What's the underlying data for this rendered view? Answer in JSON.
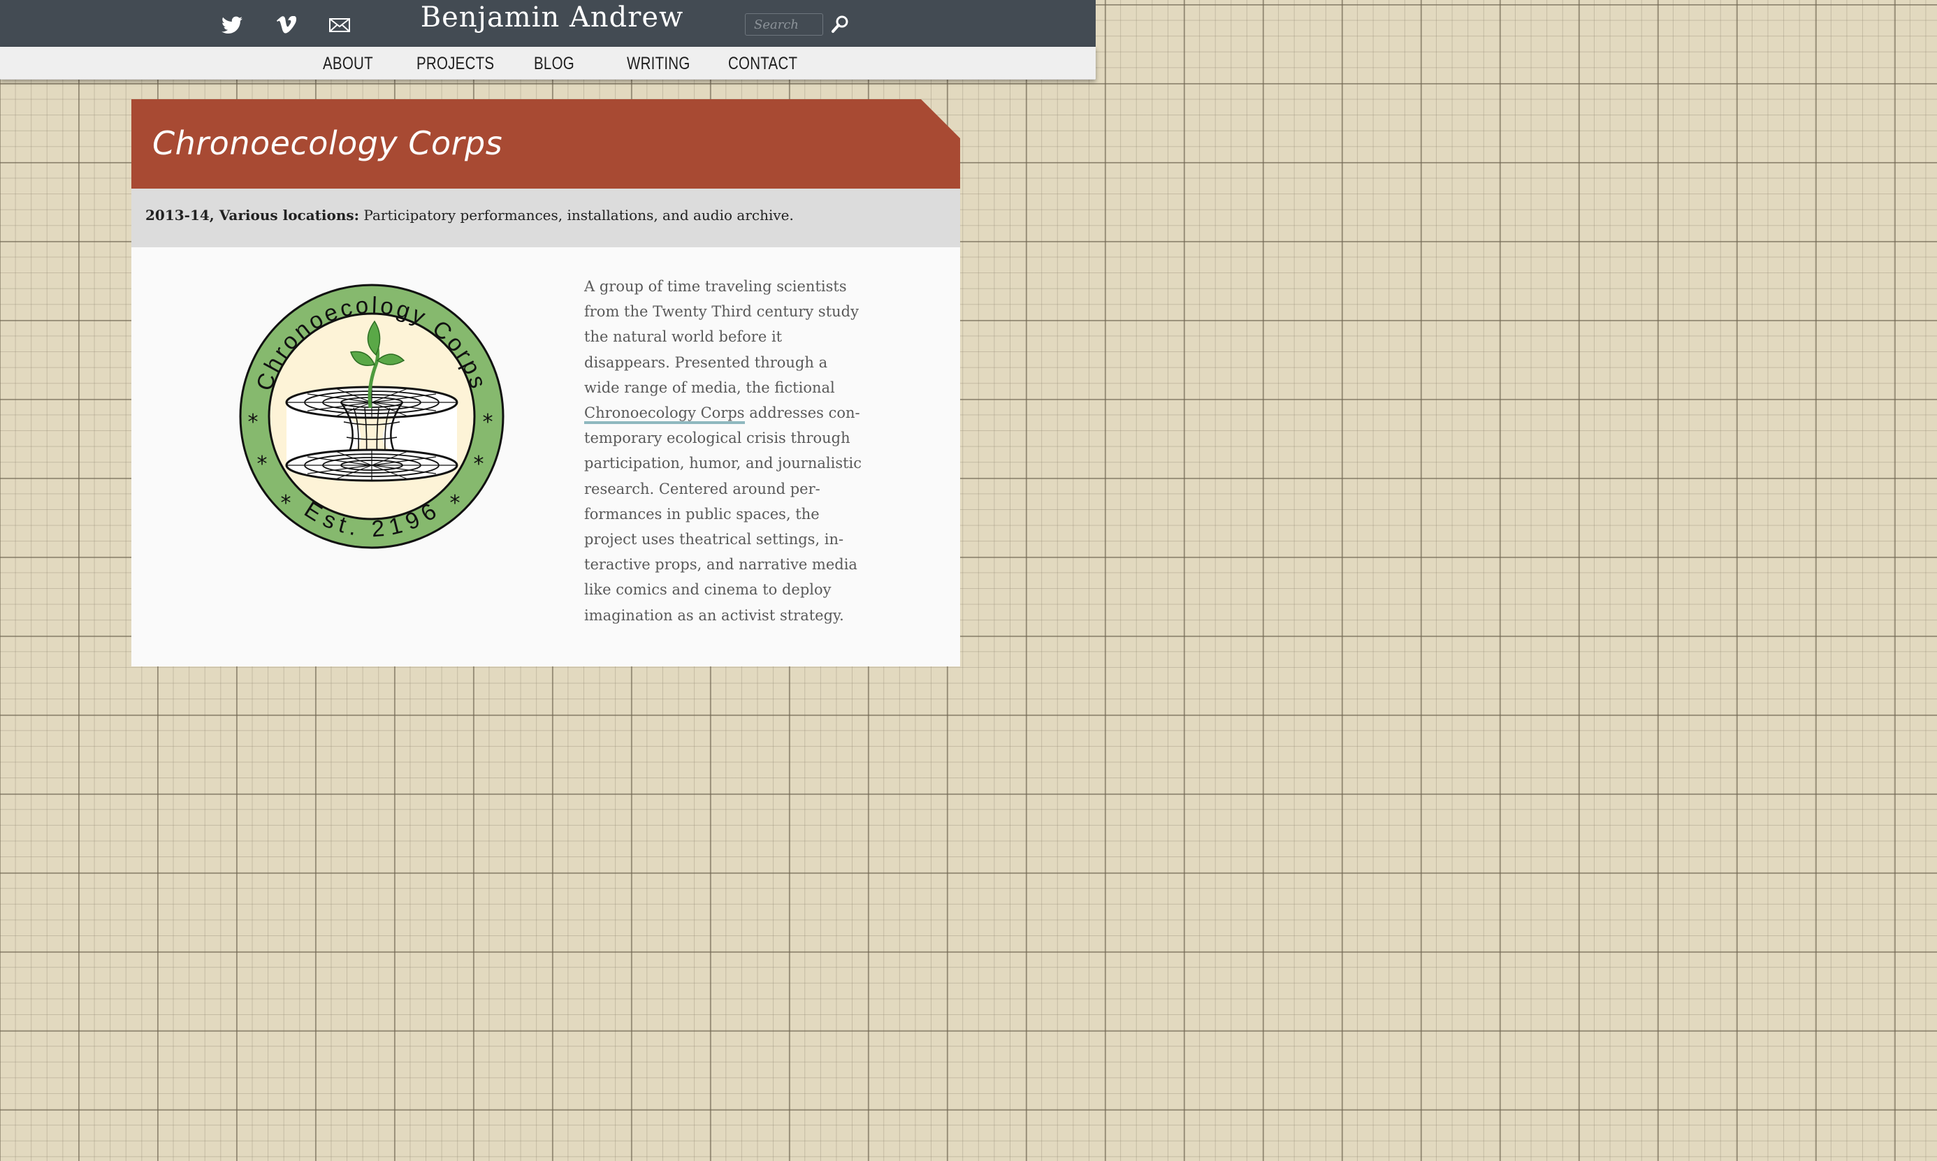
{
  "header": {
    "title": "Benjamin Andrew",
    "social_icons": [
      "twitter-icon",
      "vimeo-icon",
      "mail-icon"
    ],
    "search_placeholder": "Search",
    "search_icon": "magnifier-icon"
  },
  "nav": {
    "items": [
      {
        "label": "ABOUT"
      },
      {
        "label": "PROJECTS"
      },
      {
        "label": "BLOG"
      },
      {
        "label": "WRITING"
      },
      {
        "label": "CONTACT"
      }
    ]
  },
  "project": {
    "title": "Chronoecology Corps",
    "meta_bold": "2013-14, Various locations:",
    "meta_text": " Participatory performances, installations, and audio archive.",
    "description_before": "A group of time traveling scientists from the Twenty Third century study the natural world before it disappears. Presented through a wide range of media, the fictional ",
    "description_link": "Chronoecology Corps",
    "description_after": " addresses con­temporary ecological crisis through participation, humor, and journalis­tic research. Centered around per­formances in public spaces, the project uses theatrical settings, in­teractive props, and narrative me­dia like comics and cinema to de­ploy imagination as an activist strategy.",
    "logo": {
      "arc_top": "Chronoecology Corps",
      "arc_bottom": "Est. 2196",
      "star": "*"
    }
  },
  "colors": {
    "topbar": "#434b53",
    "banner": "#a84a33",
    "meta_bg": "#dcdcdc",
    "link_underline": "#8fb8bf",
    "logo_green": "#86b96e",
    "logo_cream": "#fdf3d7"
  }
}
